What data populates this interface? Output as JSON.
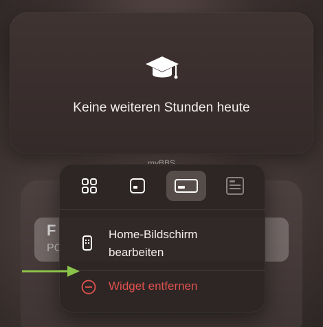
{
  "widget": {
    "message": "Keine weiteren Stunden heute",
    "icon": "graduation-cap-icon",
    "app_name": "myBBS"
  },
  "background_widget": {
    "title_fragment": "F",
    "subtitle_fragment": "PC"
  },
  "context_menu": {
    "sizes": [
      {
        "icon": "small-grid-icon",
        "selected": false
      },
      {
        "icon": "small-widget-icon",
        "selected": false
      },
      {
        "icon": "medium-widget-icon",
        "selected": true
      },
      {
        "icon": "large-widget-icon",
        "selected": false
      }
    ],
    "items": [
      {
        "label": "Home-Bildschirm bearbeiten",
        "icon": "phone-icon"
      },
      {
        "label": "Widget entfernen",
        "icon": "minus-circle-icon",
        "color": "#e0524e"
      }
    ]
  },
  "annotation": {
    "arrow_color": "#8bc34a"
  }
}
